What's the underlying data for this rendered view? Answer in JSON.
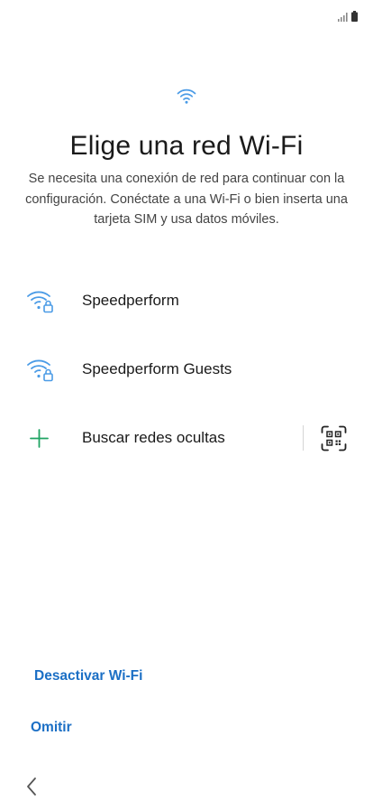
{
  "status_bar": {
    "signal_icon": "signal-bars-icon",
    "battery_icon": "battery-icon"
  },
  "header": {
    "icon": "wifi-icon",
    "title": "Elige una red Wi-Fi",
    "description": "Se necesita una conexión de red para continuar con la configuración. Conéctate a una Wi-Fi o bien inserta una tarjeta SIM y usa datos móviles."
  },
  "networks": [
    {
      "name": "Speedperform",
      "icon": "wifi-lock-icon",
      "secured": true
    },
    {
      "name": "Speedperform Guests",
      "icon": "wifi-lock-icon",
      "secured": true
    }
  ],
  "hidden_networks": {
    "label": "Buscar redes ocultas",
    "icon": "plus-icon",
    "qr_icon": "qr-code-scan-icon"
  },
  "footer": {
    "disable_wifi_label": "Desactivar Wi-Fi",
    "skip_label": "Omitir",
    "back_icon": "chevron-left-icon"
  },
  "colors": {
    "accent_blue": "#1b6fc5",
    "wifi_icon_blue": "#4a9be6",
    "plus_green": "#1fa463",
    "title_text": "#1a1a1a",
    "body_text": "#444444"
  }
}
